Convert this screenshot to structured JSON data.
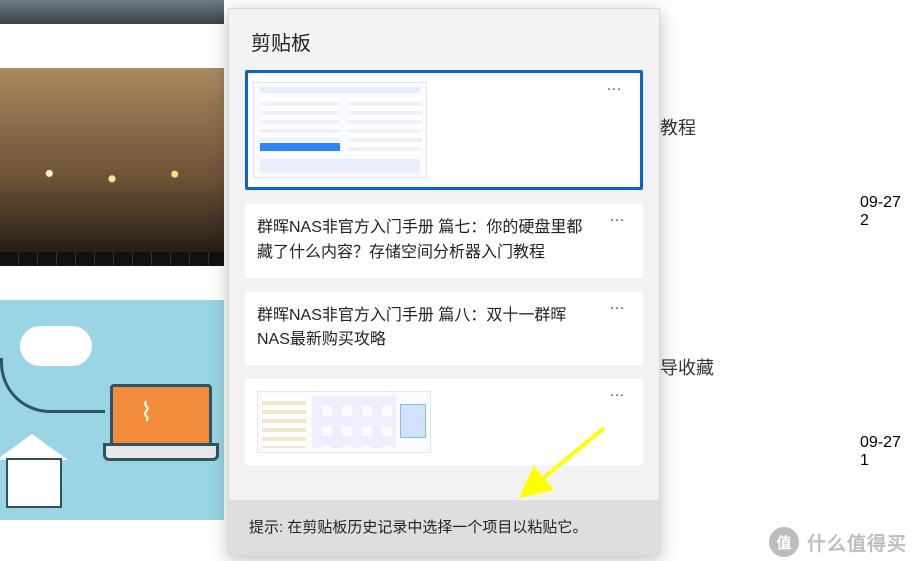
{
  "clipboard": {
    "title": "剪贴板",
    "tip": "提示: 在剪贴板历史记录中选择一个项目以粘贴它。",
    "items": [
      {
        "kind": "image",
        "selected": true
      },
      {
        "kind": "text",
        "text": "群晖NAS非官方入门手册 篇七：你的硬盘里都藏了什么内容？存储空间分析器入门教程"
      },
      {
        "kind": "text",
        "text": "群晖NAS非官方入门手册 篇八：双十一群晖NAS最新购买攻略"
      },
      {
        "kind": "image"
      }
    ],
    "more_label": "…"
  },
  "background": {
    "row1_text_fragment": "教程",
    "row2_text_fragment": "导收藏",
    "date1": "09-27 2",
    "date2": "09-27 1"
  },
  "watermark": {
    "badge": "值",
    "text": "什么值得买"
  },
  "annotation": {
    "arrow_color": "#ffff00"
  }
}
